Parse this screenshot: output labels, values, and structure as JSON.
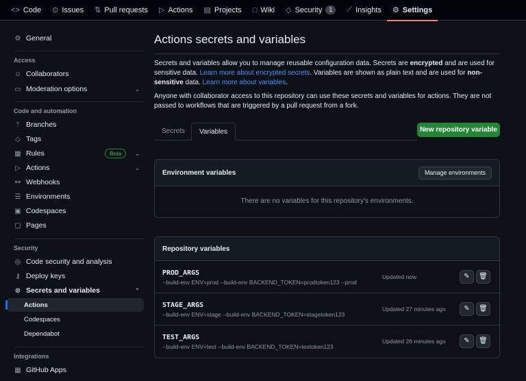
{
  "nav": {
    "items": [
      {
        "label": "Code",
        "icon": "code-icon"
      },
      {
        "label": "Issues",
        "icon": "issue-icon"
      },
      {
        "label": "Pull requests",
        "icon": "pull-request-icon"
      },
      {
        "label": "Actions",
        "icon": "play-icon"
      },
      {
        "label": "Projects",
        "icon": "table-icon"
      },
      {
        "label": "Wiki",
        "icon": "book-icon"
      },
      {
        "label": "Security",
        "icon": "shield-icon",
        "count": "1"
      },
      {
        "label": "Insights",
        "icon": "graph-icon"
      },
      {
        "label": "Settings",
        "icon": "gear-icon"
      }
    ]
  },
  "sidebar": {
    "general": "General",
    "access": "Access",
    "collaborators": "Collaborators",
    "moderation": "Moderation options",
    "code_automation": "Code and automation",
    "branches": "Branches",
    "tags": "Tags",
    "rules": "Rules",
    "beta": "Beta",
    "actions": "Actions",
    "webhooks": "Webhooks",
    "environments": "Environments",
    "codespaces": "Codespaces",
    "pages": "Pages",
    "security": "Security",
    "code_security": "Code security and analysis",
    "deploy_keys": "Deploy keys",
    "secrets": "Secrets and variables",
    "sub_actions": "Actions",
    "sub_codespaces": "Codespaces",
    "sub_dependabot": "Dependabot",
    "integrations": "Integrations",
    "github_apps": "GitHub Apps"
  },
  "main": {
    "title": "Actions secrets and variables",
    "p1a": "Secrets and variables allow you to manage reusable configuration data. Secrets are ",
    "p1b": "encrypted",
    "p1c": " and are used for sensitive data. ",
    "p1link1": "Learn more about encrypted secrets",
    "p1d": ". Variables are shown as plain text and are used for ",
    "p1e": "non-sensitive",
    "p1f": " data. ",
    "p1link2": "Learn more about variables",
    "p1g": ".",
    "p2": "Anyone with collaborator access to this repository can use these secrets and variables for actions. They are not passed to workflows that are triggered by a pull request from a fork.",
    "tab_secrets": "Secrets",
    "tab_variables": "Variables",
    "new_button": "New repository variable",
    "env_title": "Environment variables",
    "manage_env": "Manage environments",
    "env_empty": "There are no variables for this repository's environments.",
    "repo_title": "Repository variables",
    "variables": [
      {
        "name": "PROD_ARGS",
        "value": "--build-env ENV=prod --build-env BACKEND_TOKEN=prodtoken123 --prod",
        "updated": "Updated now"
      },
      {
        "name": "STAGE_ARGS",
        "value": "--build-env ENV=stage --build-env BACKEND_TOKEN=stagetoken123",
        "updated": "Updated 27 minutes ago"
      },
      {
        "name": "TEST_ARGS",
        "value": "--build-env ENV=test --build-env BACKEND_TOKEN=testoken123",
        "updated": "Updated 26 minutes ago"
      }
    ]
  }
}
